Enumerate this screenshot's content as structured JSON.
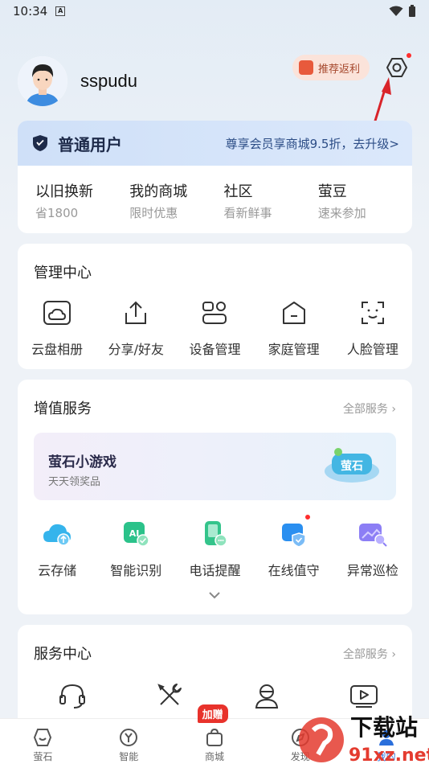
{
  "status_bar": {
    "time": "10:34",
    "notif_letter": "A"
  },
  "profile": {
    "username": "sspudu",
    "promo_label": "推荐返利"
  },
  "member": {
    "level": "普通用户",
    "upgrade_text": "尊享会员享商城9.5折，去升级>"
  },
  "quick_links": [
    {
      "title": "以旧换新",
      "sub": "省1800"
    },
    {
      "title": "我的商城",
      "sub": "限时优惠"
    },
    {
      "title": "社区",
      "sub": "看新鲜事"
    },
    {
      "title": "萤豆",
      "sub": "速来参加"
    }
  ],
  "management": {
    "title": "管理中心",
    "items": [
      {
        "label": "云盘相册",
        "icon": "cloud-album-icon"
      },
      {
        "label": "分享/好友",
        "icon": "share-icon"
      },
      {
        "label": "设备管理",
        "icon": "device-icon"
      },
      {
        "label": "家庭管理",
        "icon": "home-icon"
      },
      {
        "label": "人脸管理",
        "icon": "face-icon"
      }
    ]
  },
  "value_services": {
    "title": "增值服务",
    "more": "全部服务",
    "game_banner": {
      "title": "萤石小游戏",
      "subtitle": "天天领奖品",
      "logo_text": "萤石"
    },
    "items": [
      {
        "label": "云存储",
        "icon": "cloud-storage-icon"
      },
      {
        "label": "智能识别",
        "icon": "ai-icon"
      },
      {
        "label": "电话提醒",
        "icon": "phone-icon"
      },
      {
        "label": "在线值守",
        "icon": "guard-icon"
      },
      {
        "label": "异常巡检",
        "icon": "inspect-icon"
      }
    ]
  },
  "service_center": {
    "title": "服务中心",
    "more": "全部服务",
    "items": [
      {
        "icon": "headset-icon"
      },
      {
        "icon": "tools-icon"
      },
      {
        "icon": "agent-icon"
      },
      {
        "icon": "video-icon"
      }
    ]
  },
  "bottom_nav": {
    "items": [
      {
        "label": "萤石",
        "icon": "yingshi-icon"
      },
      {
        "label": "智能",
        "icon": "smart-icon"
      },
      {
        "label": "商城",
        "icon": "mall-icon",
        "badge": "加赠"
      },
      {
        "label": "发现",
        "icon": "discover-icon"
      },
      {
        "label": "我的",
        "icon": "me-icon"
      }
    ]
  },
  "watermark": {
    "text": "下载站",
    "domain": "91xz.net"
  },
  "colors": {
    "accent_red": "#e8322b",
    "member_blue": "#cfe0f8",
    "brand_blue": "#2c4d86"
  }
}
